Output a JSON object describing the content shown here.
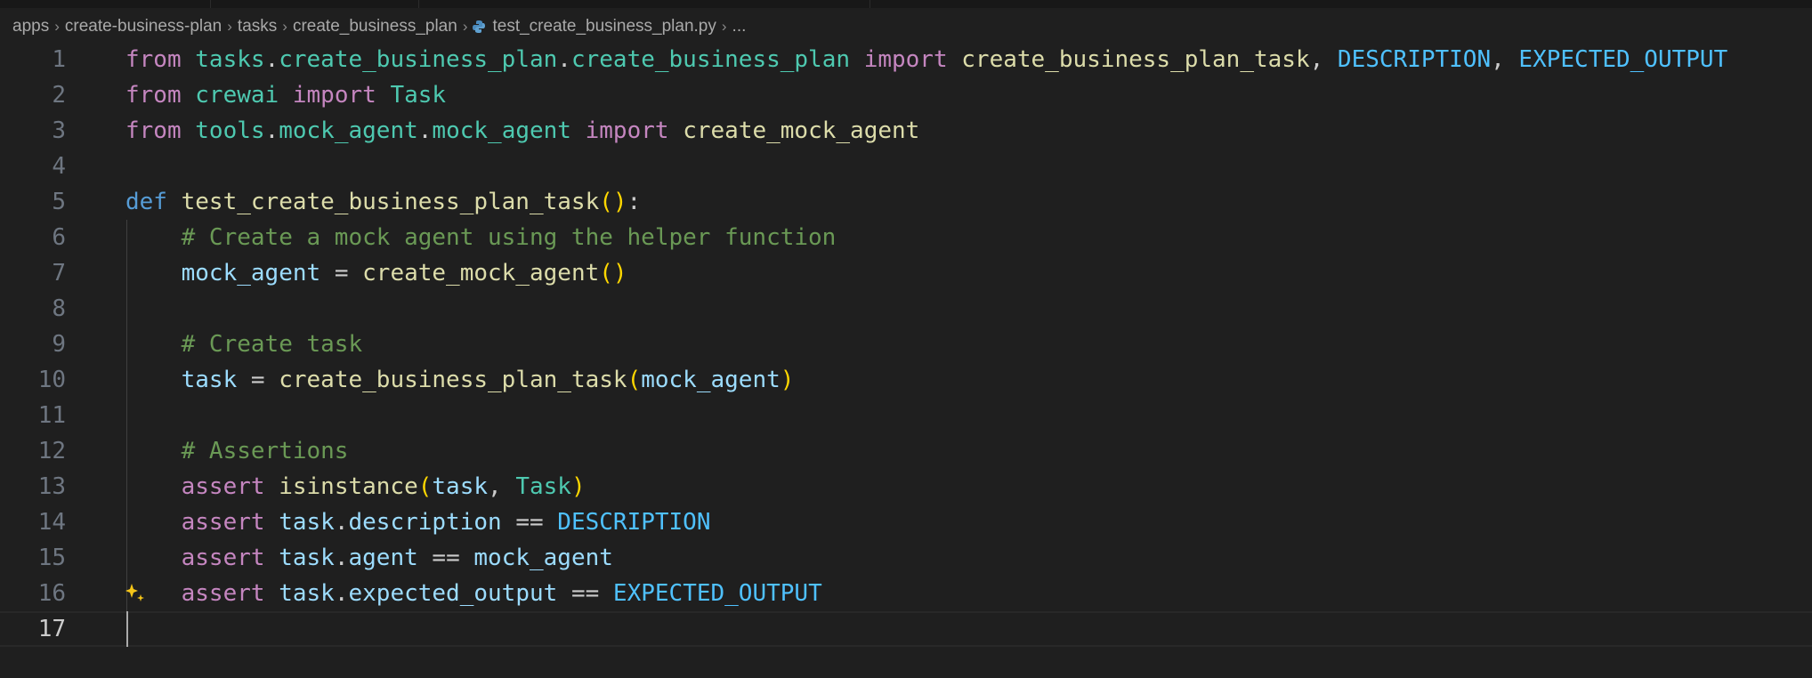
{
  "breadcrumb": [
    "apps",
    "create-business-plan",
    "tasks",
    "create_business_plan",
    "test_create_business_plan.py",
    "..."
  ],
  "editor": {
    "current_line": 17,
    "lines": [
      {
        "n": "1",
        "tokens": [
          [
            "kw",
            "from"
          ],
          [
            "p",
            " "
          ],
          [
            "mod",
            "tasks"
          ],
          [
            "p",
            "."
          ],
          [
            "mod",
            "create_business_plan"
          ],
          [
            "p",
            "."
          ],
          [
            "mod",
            "create_business_plan"
          ],
          [
            "p",
            " "
          ],
          [
            "kw",
            "import"
          ],
          [
            "p",
            " "
          ],
          [
            "fn",
            "create_business_plan_task"
          ],
          [
            "p",
            ", "
          ],
          [
            "const",
            "DESCRIPTION"
          ],
          [
            "p",
            ", "
          ],
          [
            "const",
            "EXPECTED_OUTPUT"
          ]
        ]
      },
      {
        "n": "2",
        "tokens": [
          [
            "kw",
            "from"
          ],
          [
            "p",
            " "
          ],
          [
            "mod",
            "crewai"
          ],
          [
            "p",
            " "
          ],
          [
            "kw",
            "import"
          ],
          [
            "p",
            " "
          ],
          [
            "cls",
            "Task"
          ]
        ]
      },
      {
        "n": "3",
        "tokens": [
          [
            "kw",
            "from"
          ],
          [
            "p",
            " "
          ],
          [
            "mod",
            "tools"
          ],
          [
            "p",
            "."
          ],
          [
            "mod",
            "mock_agent"
          ],
          [
            "p",
            "."
          ],
          [
            "mod",
            "mock_agent"
          ],
          [
            "p",
            " "
          ],
          [
            "kw",
            "import"
          ],
          [
            "p",
            " "
          ],
          [
            "fn",
            "create_mock_agent"
          ]
        ]
      },
      {
        "n": "4",
        "tokens": []
      },
      {
        "n": "5",
        "tokens": [
          [
            "def",
            "def"
          ],
          [
            "p",
            " "
          ],
          [
            "fn",
            "test_create_business_plan_task"
          ],
          [
            "br",
            "()"
          ],
          [
            "p",
            ":"
          ]
        ]
      },
      {
        "n": "6",
        "indent": true,
        "tokens": [
          [
            "p",
            "    "
          ],
          [
            "cm",
            "# Create a mock agent using the helper function"
          ]
        ]
      },
      {
        "n": "7",
        "indent": true,
        "tokens": [
          [
            "p",
            "    "
          ],
          [
            "var",
            "mock_agent"
          ],
          [
            "p",
            " = "
          ],
          [
            "fn",
            "create_mock_agent"
          ],
          [
            "br",
            "()"
          ]
        ]
      },
      {
        "n": "8",
        "indent": true,
        "tokens": []
      },
      {
        "n": "9",
        "indent": true,
        "tokens": [
          [
            "p",
            "    "
          ],
          [
            "cm",
            "# Create task"
          ]
        ]
      },
      {
        "n": "10",
        "indent": true,
        "tokens": [
          [
            "p",
            "    "
          ],
          [
            "var",
            "task"
          ],
          [
            "p",
            " = "
          ],
          [
            "fn",
            "create_business_plan_task"
          ],
          [
            "br",
            "("
          ],
          [
            "var",
            "mock_agent"
          ],
          [
            "br",
            ")"
          ]
        ]
      },
      {
        "n": "11",
        "indent": true,
        "tokens": []
      },
      {
        "n": "12",
        "indent": true,
        "tokens": [
          [
            "p",
            "    "
          ],
          [
            "cm",
            "# Assertions"
          ]
        ]
      },
      {
        "n": "13",
        "indent": true,
        "tokens": [
          [
            "p",
            "    "
          ],
          [
            "kw",
            "assert"
          ],
          [
            "p",
            " "
          ],
          [
            "fn",
            "isinstance"
          ],
          [
            "br",
            "("
          ],
          [
            "var",
            "task"
          ],
          [
            "p",
            ", "
          ],
          [
            "cls",
            "Task"
          ],
          [
            "br",
            ")"
          ]
        ]
      },
      {
        "n": "14",
        "indent": true,
        "tokens": [
          [
            "p",
            "    "
          ],
          [
            "kw",
            "assert"
          ],
          [
            "p",
            " "
          ],
          [
            "var",
            "task"
          ],
          [
            "p",
            "."
          ],
          [
            "var",
            "description"
          ],
          [
            "p",
            " == "
          ],
          [
            "const",
            "DESCRIPTION"
          ]
        ]
      },
      {
        "n": "15",
        "indent": true,
        "tokens": [
          [
            "p",
            "    "
          ],
          [
            "kw",
            "assert"
          ],
          [
            "p",
            " "
          ],
          [
            "var",
            "task"
          ],
          [
            "p",
            "."
          ],
          [
            "var",
            "agent"
          ],
          [
            "p",
            " == "
          ],
          [
            "var",
            "mock_agent"
          ]
        ]
      },
      {
        "n": "16",
        "indent": true,
        "sparkle": true,
        "tokens": [
          [
            "p",
            "    "
          ],
          [
            "kw",
            "assert"
          ],
          [
            "p",
            " "
          ],
          [
            "var",
            "task"
          ],
          [
            "p",
            "."
          ],
          [
            "var",
            "expected_output"
          ],
          [
            "p",
            " == "
          ],
          [
            "const",
            "EXPECTED_OUTPUT"
          ]
        ]
      },
      {
        "n": "17",
        "indent": true,
        "tokens": []
      }
    ]
  },
  "colors": {
    "background": "#1f1f1f",
    "keyword": "#C586C0",
    "module": "#4EC9B0",
    "function": "#DCDCAA",
    "constant": "#4FC1FF",
    "variable": "#9CDCFE",
    "comment": "#6A9955",
    "bracket": "#FFD700"
  }
}
